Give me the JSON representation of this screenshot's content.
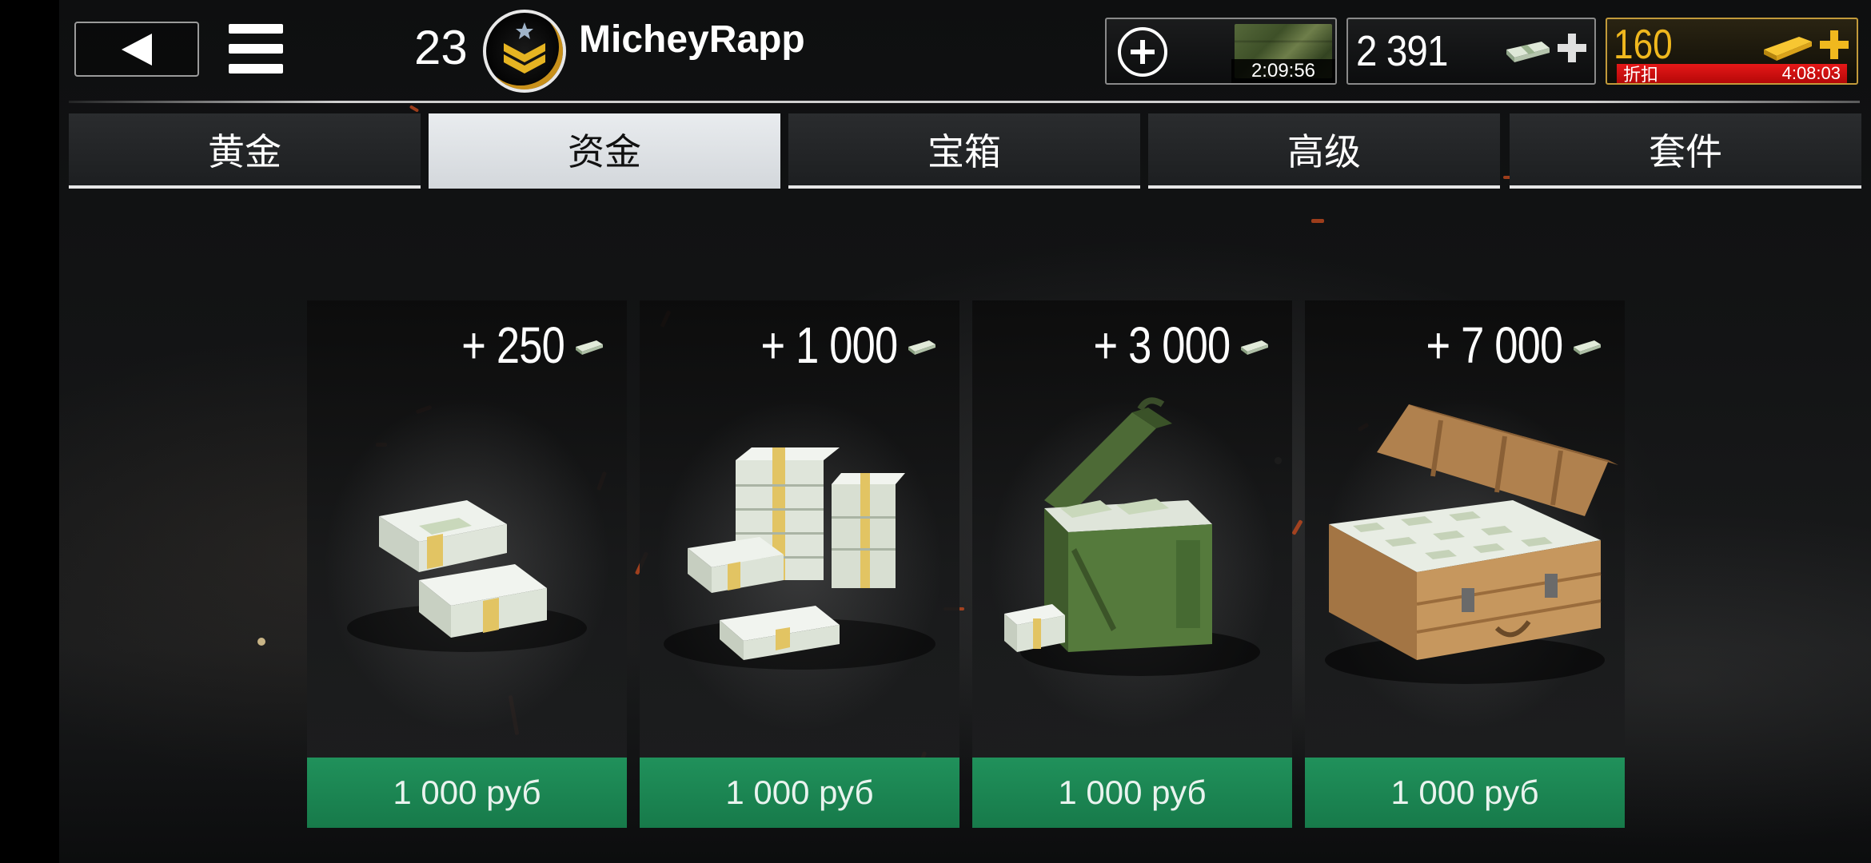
{
  "header": {
    "level": "23",
    "username": "MicheyRapp",
    "crate_timer": "2:09:56",
    "cash_balance": "2 391",
    "gold_balance": "160",
    "sale_label": "折扣",
    "sale_timer": "4:08:03"
  },
  "tabs": [
    {
      "label": "黄金",
      "active": false
    },
    {
      "label": "资金",
      "active": true
    },
    {
      "label": "宝箱",
      "active": false
    },
    {
      "label": "高级",
      "active": false
    },
    {
      "label": "套件",
      "active": false
    }
  ],
  "offers": [
    {
      "amount": "+ 250",
      "price": "1 000 руб",
      "art": "small-cash-stacks"
    },
    {
      "amount": "+ 1 000",
      "price": "1 000 руб",
      "art": "medium-cash-pile"
    },
    {
      "amount": "+ 3 000",
      "price": "1 000 руб",
      "art": "ammo-box-cash"
    },
    {
      "amount": "+ 7 000",
      "price": "1 000 руб",
      "art": "wooden-crate-cash"
    }
  ],
  "colors": {
    "buy_green": "#1c8a55",
    "gold": "#f0b81e",
    "sale_red": "#e01010"
  },
  "icons": {
    "back": "back-arrow-icon",
    "menu": "hamburger-menu-icon",
    "rank": "sergeant-rank-icon",
    "cash": "cash-icon",
    "gold": "gold-bar-icon",
    "add": "plus-icon"
  }
}
